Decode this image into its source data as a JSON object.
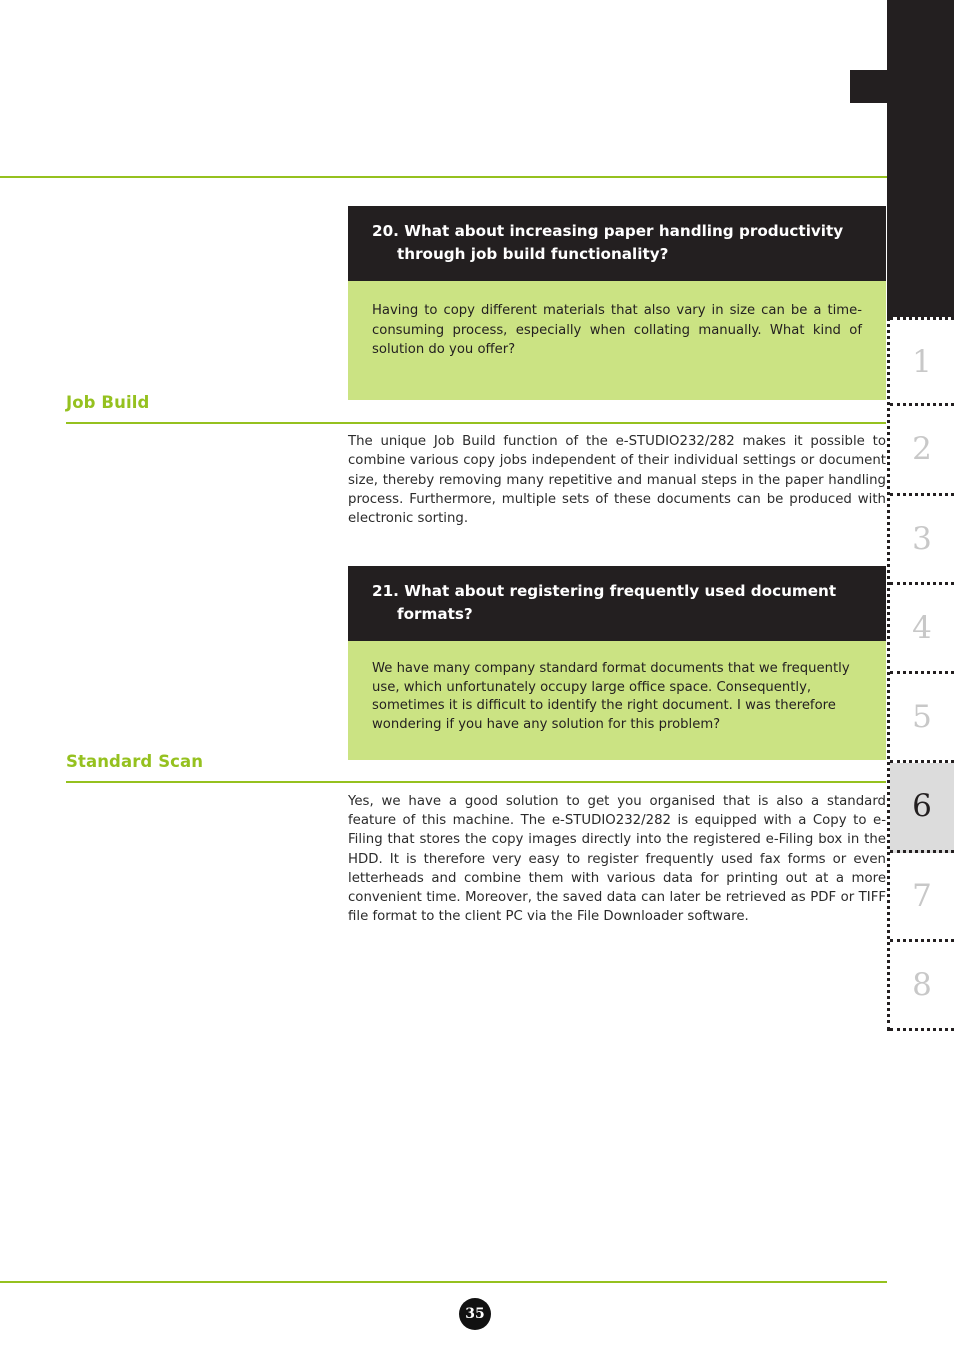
{
  "page": {
    "number": "35",
    "accent_green": "#95c11f",
    "panel_green": "#cbe383",
    "panel_black": "#231f20"
  },
  "qa_blocks": [
    {
      "number": "20.",
      "question_line1": "What about increasing paper handling productivity",
      "question_line2": "through job build functionality?",
      "answer": "Having to copy different materials that also vary in size can be a time-consuming process, especially when collating manually. What kind of solution do you offer?"
    },
    {
      "number": "21.",
      "question_line1": "What about registering frequently used document",
      "question_line2": "formats?",
      "answer": "We have many company standard format documents that we frequently use, which unfortunately occupy large office space. Consequently, sometimes it is difficult to identify the right document. I was therefore wondering if you have any solution for this problem?"
    }
  ],
  "sections": [
    {
      "title": "Job Build",
      "body": "The unique Job Build function of the e-STUDIO232/282 makes it possible to combine various copy jobs independent of their individual settings or document size, thereby removing many repetitive and manual steps in the paper handling process. Furthermore, multiple sets of these documents can be produced with electronic sorting."
    },
    {
      "title": "Standard Scan",
      "body": "Yes, we have a good solution to get you organised that is also a standard feature of this machine. The e-STUDIO232/282 is equipped with a Copy to e-Filing that stores the copy images directly into the registered e-Filing box in the HDD. It is therefore very easy to register frequently used fax forms or even letterheads and combine them with various data for printing out at a more convenient time. Moreover, the saved data can later be retrieved as PDF or TIFF file format to the client PC via the File Downloader software."
    }
  ],
  "tab_index": {
    "active": "6",
    "items": [
      {
        "label": "1"
      },
      {
        "label": "2"
      },
      {
        "label": "3"
      },
      {
        "label": "4"
      },
      {
        "label": "5"
      },
      {
        "label": "6"
      },
      {
        "label": "7"
      },
      {
        "label": "8"
      }
    ]
  }
}
